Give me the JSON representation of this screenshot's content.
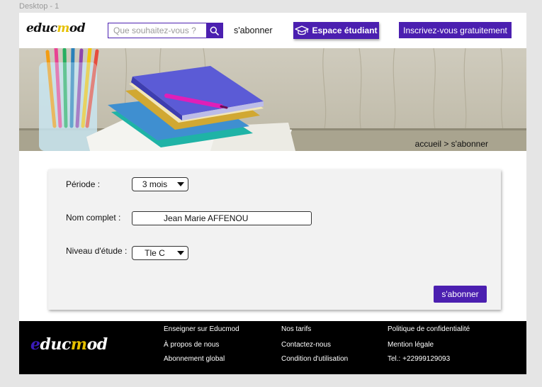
{
  "frame_label": "Desktop - 1",
  "header": {
    "logo": {
      "part1": "educ",
      "part2": "m",
      "part3": "od"
    },
    "search_placeholder": "Que souhaitez-vous ?",
    "subscribe_link": "s'abonner",
    "student_space_button": "Espace étudiant",
    "register_button": "Inscrivez-vous gratuitement"
  },
  "hero": {
    "breadcrumb": "accueil > s'abonner"
  },
  "form": {
    "period_label": "Période :",
    "period_value": "3 mois",
    "name_label": "Nom complet :",
    "name_value": "Jean Marie AFFENOU",
    "level_label": "Niveau d'étude :",
    "level_value": "Tle C",
    "submit_button": "s'abonner"
  },
  "footer": {
    "logo": {
      "part1": "e",
      "part2": "duc",
      "part3": "m",
      "part4": "od"
    },
    "col1": [
      "Enseigner sur Educmod",
      "À propos de nous",
      "Abonnement global"
    ],
    "col2": [
      "Nos tarifs",
      "Contactez-nous",
      "Condition d'utilisation"
    ],
    "col3": [
      "Politique de confidentialité",
      "Mention légale",
      "Tel.:  +22999129093"
    ]
  },
  "colors": {
    "brand": "#4b1fb0",
    "logo_accent": "#e5c000",
    "footer_bg": "#000000"
  },
  "icons": {
    "search": "search-icon",
    "student": "graduation-cap-icon",
    "dropdown": "chevron-down-icon"
  }
}
